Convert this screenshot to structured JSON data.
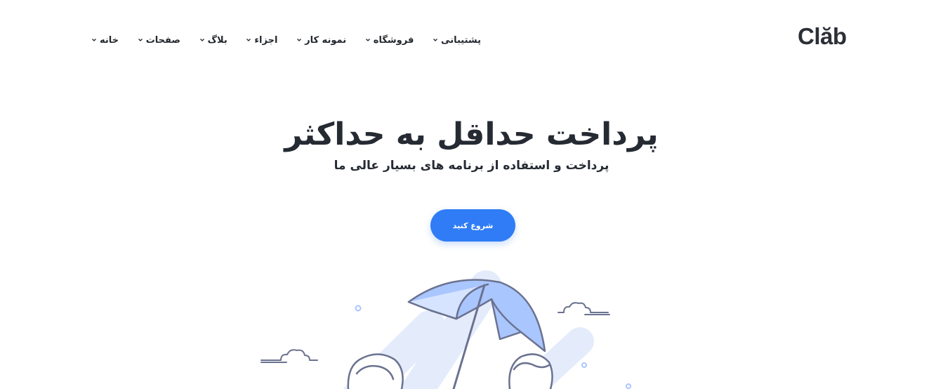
{
  "brand": {
    "logo_text": "Clăb"
  },
  "nav": {
    "items": [
      {
        "label": "خانه"
      },
      {
        "label": "صفحات"
      },
      {
        "label": "بلاگ"
      },
      {
        "label": "اجزاء"
      },
      {
        "label": "نمونه کار"
      },
      {
        "label": "فروشگاه"
      },
      {
        "label": "پشتیبانی"
      }
    ]
  },
  "hero": {
    "title": "پرداخت حداقل به حداکثر",
    "subtitle": "پرداخت و استفاده از برنامه های بسیار عالی ما",
    "cta_label": "شروع کنید"
  },
  "colors": {
    "accent": "#2f7cf6",
    "text": "#252a33",
    "illustration_light": "#e4ecfb",
    "illustration_mid": "#a9c6ff",
    "illustration_stroke": "#6b7290"
  }
}
